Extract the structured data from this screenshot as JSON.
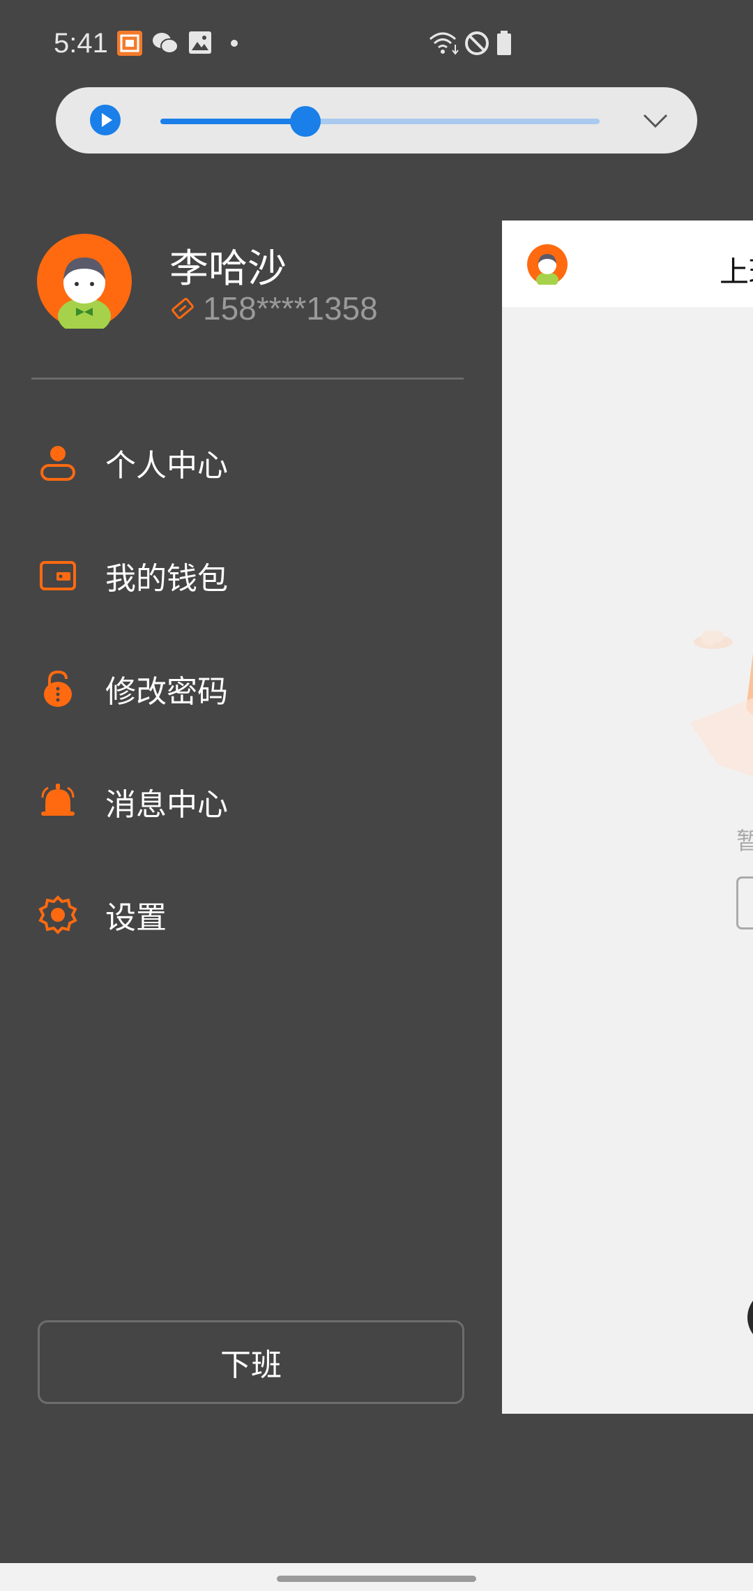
{
  "status_bar": {
    "time": "5:41",
    "left_icons": [
      "app-notification-icon",
      "wechat-icon",
      "gallery-icon",
      "more-dot-icon"
    ],
    "right_icons": [
      "wifi-icon",
      "do-not-disturb-icon",
      "battery-icon"
    ]
  },
  "media_player": {
    "progress": 0.33,
    "accent": "#1a7fe8",
    "icons": [
      "play-icon",
      "chevron-down-icon"
    ]
  },
  "drawer": {
    "user_name": "李哈沙",
    "phone": "158****1358",
    "menu": [
      {
        "label": "个人中心",
        "icon": "person-icon"
      },
      {
        "label": "我的钱包",
        "icon": "wallet-icon"
      },
      {
        "label": "修改密码",
        "icon": "lock-icon"
      },
      {
        "label": "消息中心",
        "icon": "bell-icon"
      },
      {
        "label": "设置",
        "icon": "gear-icon"
      }
    ],
    "logout_label": "下班",
    "accent": "#ff6a10"
  },
  "main": {
    "title": "上班",
    "empty_text": "暂"
  }
}
